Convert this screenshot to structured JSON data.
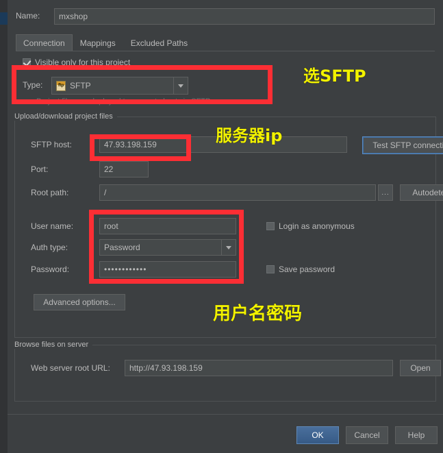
{
  "window": {
    "background": "#3c3f41",
    "accent": "#4a6f9c"
  },
  "name_row": {
    "label": "Name:",
    "value": "mxshop",
    "placeholder": ""
  },
  "tabs": [
    {
      "label": "Connection",
      "selected": true
    },
    {
      "label": "Mappings",
      "selected": false
    },
    {
      "label": "Excluded Paths",
      "selected": false
    }
  ],
  "visible_only": {
    "label": "Visible only for this project",
    "checked": true
  },
  "type_row": {
    "label": "Type:",
    "value": "SFTP",
    "icon": "sftp-file-icon",
    "icon_text": "ftp",
    "hint": "Project files are deployed to a remote host via SFTP"
  },
  "upload_group": {
    "title": "Upload/download project files",
    "host": {
      "label": "SFTP host:",
      "value": "47.93.198.159"
    },
    "port": {
      "label": "Port:",
      "value": "22"
    },
    "root_path": {
      "label": "Root path:",
      "value": "/"
    },
    "user_name": {
      "label": "User name:",
      "value": "root"
    },
    "auth_type": {
      "label": "Auth type:",
      "value": "Password"
    },
    "password": {
      "label": "Password:",
      "value": "••••••••••••"
    },
    "login_anonymous": {
      "label": "Login as anonymous",
      "checked": false
    },
    "save_password": {
      "label": "Save password",
      "checked": false
    },
    "test_connection_button": "Test SFTP connection...",
    "autodetect_button": "Autodetect",
    "browse_button": "...",
    "advanced_options_button": "Advanced options..."
  },
  "browse_group": {
    "title": "Browse files on server",
    "web_root_url": {
      "label": "Web server root URL:",
      "value": "http://47.93.198.159"
    },
    "open_button": "Open"
  },
  "footer": {
    "ok_button": "OK",
    "cancel_button": "Cancel",
    "help_button": "Help"
  },
  "annotations": {
    "color": "#f2f200",
    "box_color": "#fc2e34",
    "items": [
      {
        "text": "选SFTP"
      },
      {
        "text": "服务器ip"
      },
      {
        "text": "用户名密码"
      }
    ]
  }
}
